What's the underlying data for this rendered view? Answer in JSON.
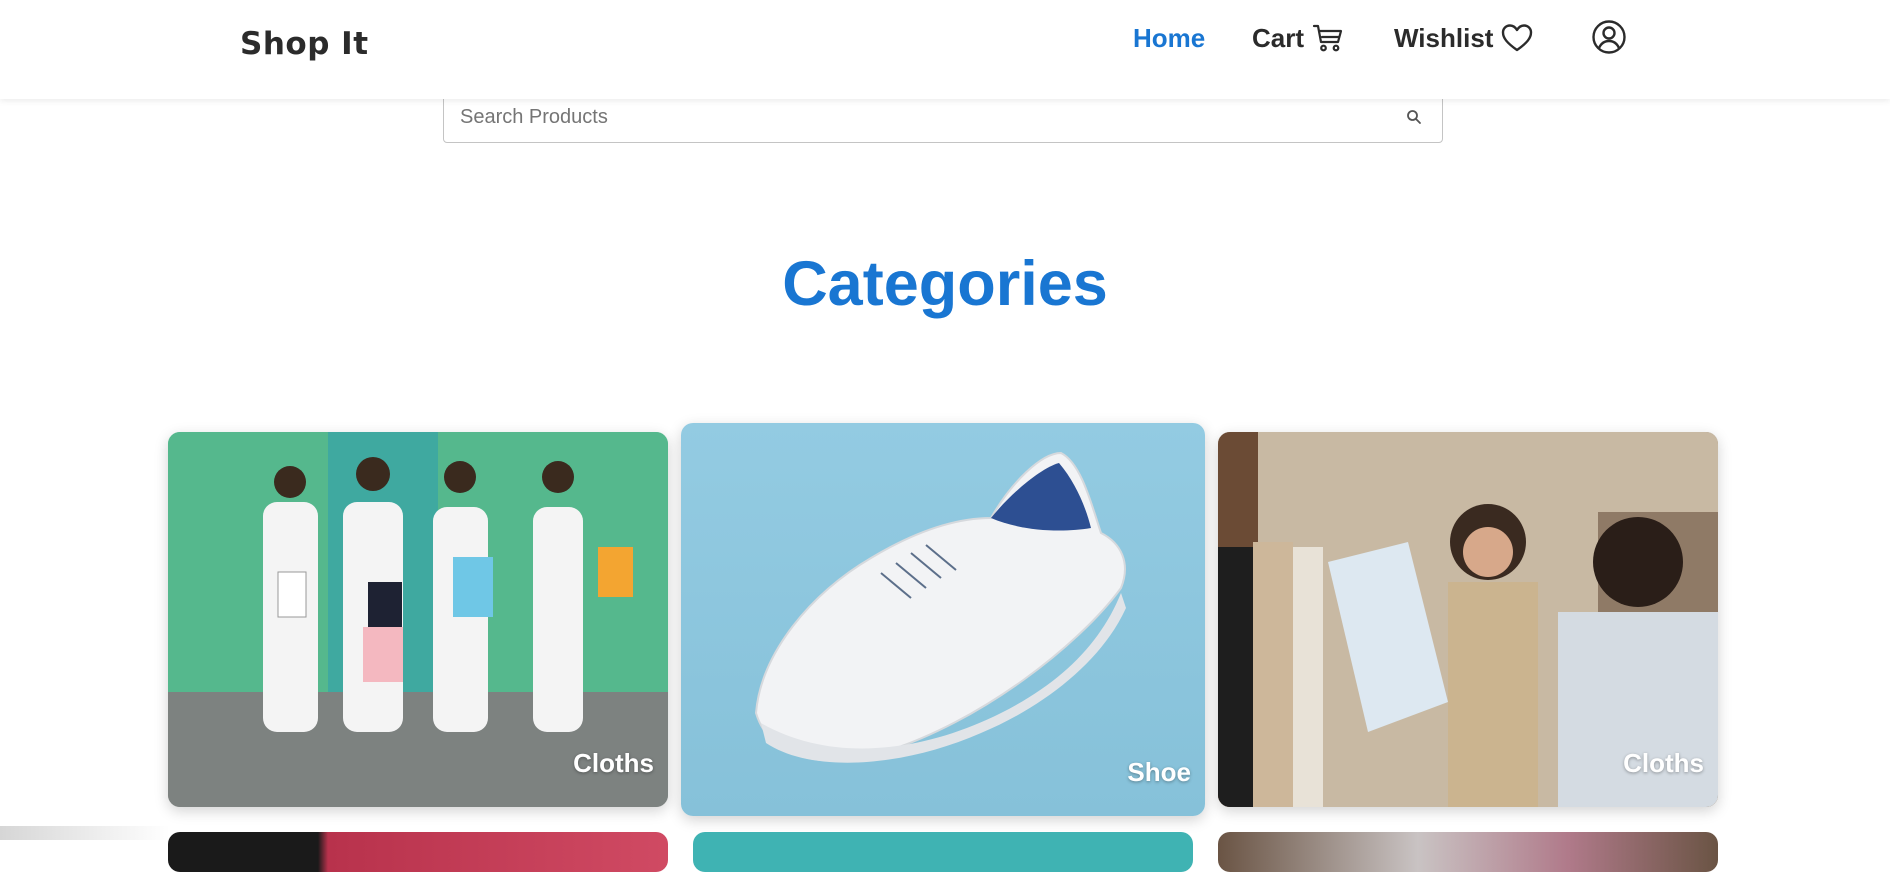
{
  "brand": {
    "name": "Shop It"
  },
  "nav": {
    "home": "Home",
    "cart": "Cart",
    "wishlist": "Wishlist"
  },
  "search": {
    "placeholder": "Search Products"
  },
  "section": {
    "title": "Categories"
  },
  "categories": [
    {
      "label": "Cloths"
    },
    {
      "label": "Shoe"
    },
    {
      "label": "Cloths"
    }
  ],
  "colors": {
    "accent": "#1976d2",
    "text": "#2b2b2b",
    "background": "#ffffff"
  },
  "icons": [
    "cart-icon",
    "heart-icon",
    "account-circle-icon",
    "search-icon"
  ]
}
